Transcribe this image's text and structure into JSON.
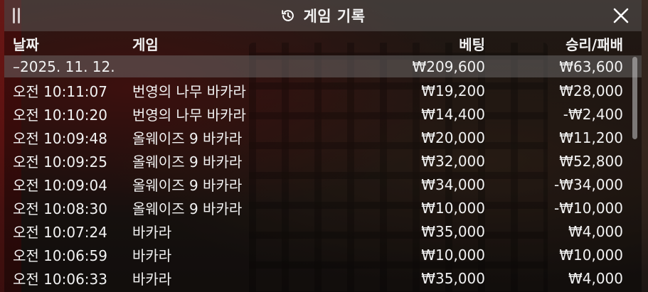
{
  "header": {
    "title": "게임 기록"
  },
  "columns": {
    "date": "날짜",
    "game": "게임",
    "bet": "베팅",
    "result": "승리/패배"
  },
  "summary": {
    "date": "–2025. 11. 12.",
    "bet": "₩209,600",
    "result": "₩63,600"
  },
  "rows": [
    {
      "time": "오전 10:11:07",
      "game": "번영의 나무 바카라",
      "bet": "₩19,200",
      "result": "₩28,000"
    },
    {
      "time": "오전 10:10:20",
      "game": "번영의 나무 바카라",
      "bet": "₩14,400",
      "result": "-₩2,400"
    },
    {
      "time": "오전 10:09:48",
      "game": "올웨이즈 9 바카라",
      "bet": "₩20,000",
      "result": "₩11,200"
    },
    {
      "time": "오전 10:09:25",
      "game": "올웨이즈 9 바카라",
      "bet": "₩32,000",
      "result": "₩52,800"
    },
    {
      "time": "오전 10:09:04",
      "game": "올웨이즈 9 바카라",
      "bet": "₩34,000",
      "result": "-₩34,000"
    },
    {
      "time": "오전 10:08:30",
      "game": "올웨이즈 9 바카라",
      "bet": "₩10,000",
      "result": "-₩10,000"
    },
    {
      "time": "오전 10:07:24",
      "game": "바카라",
      "bet": "₩35,000",
      "result": "₩4,000"
    },
    {
      "time": "오전 10:06:59",
      "game": "바카라",
      "bet": "₩10,000",
      "result": "₩10,000"
    },
    {
      "time": "오전 10:06:33",
      "game": "바카라",
      "bet": "₩35,000",
      "result": "₩4,000"
    }
  ],
  "icons": {
    "drag": "drag-handle-icon",
    "history": "history-icon",
    "close": "close-icon"
  }
}
